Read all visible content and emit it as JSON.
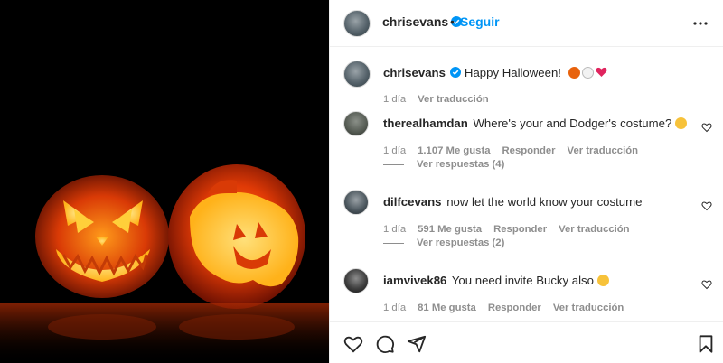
{
  "header": {
    "username": "chrisevans",
    "separator": "•",
    "follow_label": "Seguir"
  },
  "caption": {
    "username": "chrisevans",
    "text": "Happy Halloween!",
    "time": "1 día",
    "translate": "Ver traducción"
  },
  "comments": [
    {
      "username": "therealhamdan",
      "text": "Where's your and Dodger's costume?",
      "emoji": "laughing-emoji",
      "time": "1 día",
      "likes": "1.107 Me gusta",
      "reply": "Responder",
      "translate": "Ver traducción",
      "view_replies": "Ver respuestas (4)"
    },
    {
      "username": "dilfcevans",
      "text": "now let the world know your costume",
      "time": "1 día",
      "likes": "591 Me gusta",
      "reply": "Responder",
      "translate": "Ver traducción",
      "view_replies": "Ver respuestas (2)"
    },
    {
      "username": "iamvivek86",
      "text": "You need invite Bucky also",
      "emoji": "laughing-emoji",
      "time": "1 día",
      "likes": "81 Me gusta",
      "reply": "Responder",
      "translate": "Ver traducción"
    }
  ],
  "icons": {
    "verified": "verified-badge-icon",
    "more": "more-options-icon",
    "like": "heart-icon",
    "comment": "comment-icon",
    "share": "share-icon",
    "save": "bookmark-icon"
  },
  "colors": {
    "accent": "#0095f6",
    "text": "#262626",
    "muted": "#8e8e8e",
    "pumpkin": "#e84a0c"
  }
}
